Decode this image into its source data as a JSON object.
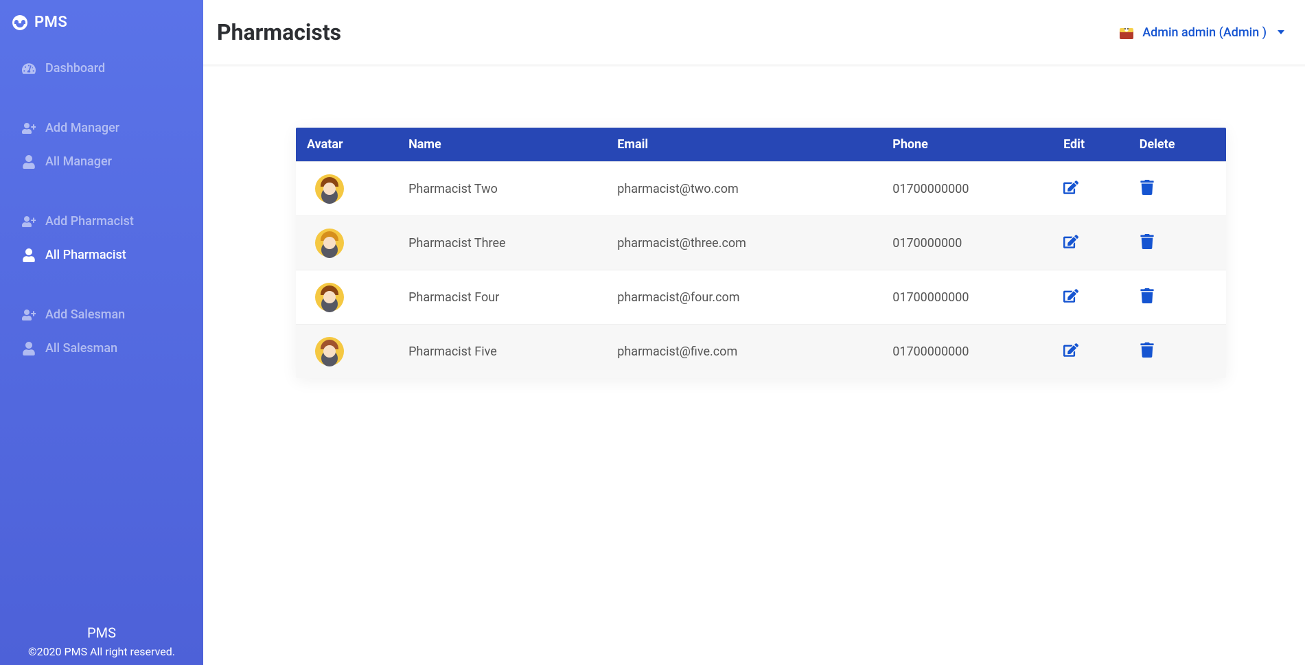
{
  "brand": "PMS",
  "sidebar": {
    "groups": [
      {
        "items": [
          {
            "label": "Dashboard",
            "icon": "gauge",
            "active": false
          }
        ]
      },
      {
        "items": [
          {
            "label": "Add Manager",
            "icon": "user-plus",
            "active": false
          },
          {
            "label": "All Manager",
            "icon": "user",
            "active": false
          }
        ]
      },
      {
        "items": [
          {
            "label": "Add Pharmacist",
            "icon": "user-plus",
            "active": false
          },
          {
            "label": "All Pharmacist",
            "icon": "user",
            "active": true
          }
        ]
      },
      {
        "items": [
          {
            "label": "Add Salesman",
            "icon": "user-plus",
            "active": false
          },
          {
            "label": "All Salesman",
            "icon": "user",
            "active": false
          }
        ]
      }
    ]
  },
  "footer": {
    "brand": "PMS",
    "copy": "©2020 PMS All right reserved."
  },
  "header": {
    "title": "Pharmacists",
    "user_label": "Admin admin (Admin )"
  },
  "table": {
    "columns": [
      "Avatar",
      "Name",
      "Email",
      "Phone",
      "Edit",
      "Delete"
    ],
    "rows": [
      {
        "name": "Pharmacist Two",
        "email": "pharmacist@two.com",
        "phone": "01700000000",
        "avatarColor": "0"
      },
      {
        "name": "Pharmacist Three",
        "email": "pharmacist@three.com",
        "phone": "0170000000",
        "avatarColor": "1"
      },
      {
        "name": "Pharmacist Four",
        "email": "pharmacist@four.com",
        "phone": "01700000000",
        "avatarColor": "2"
      },
      {
        "name": "Pharmacist Five",
        "email": "pharmacist@five.com",
        "phone": "01700000000",
        "avatarColor": "3"
      }
    ]
  }
}
